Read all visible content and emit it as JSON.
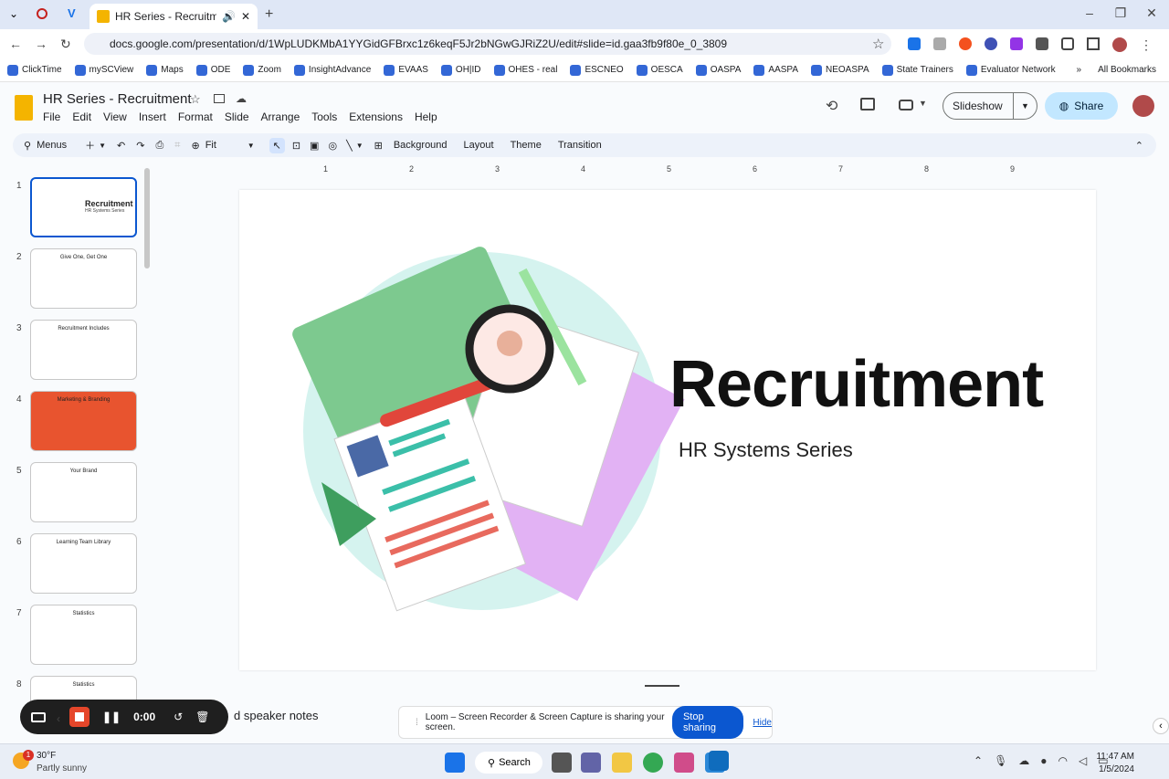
{
  "browser": {
    "tab_title": "HR Series - Recruitment - G",
    "url": "docs.google.com/presentation/d/1WpLUDKMbA1YYGidGFBrxc1z6keqF5Jr2bNGwGJRiZ2U/edit#slide=id.gaa3fb9f80e_0_3809",
    "bookmarks": [
      "ClickTime",
      "mySCView",
      "Maps",
      "ODE",
      "Zoom",
      "InsightAdvance",
      "EVAAS",
      "OH|ID",
      "OHES - real",
      "ESCNEO",
      "OESCA",
      "OASPA",
      "AASPA",
      "NEOASPA",
      "State Trainers",
      "Evaluator Network"
    ],
    "all_bookmarks": "All Bookmarks"
  },
  "doc": {
    "title": "HR Series - Recruitment",
    "menu": [
      "File",
      "Edit",
      "View",
      "Insert",
      "Format",
      "Slide",
      "Arrange",
      "Tools",
      "Extensions",
      "Help"
    ],
    "slideshow": "Slideshow",
    "share": "Share"
  },
  "toolbar": {
    "menus": "Menus",
    "zoom": "Fit",
    "items": [
      "Background",
      "Layout",
      "Theme",
      "Transition"
    ]
  },
  "ruler": [
    "1",
    "2",
    "3",
    "4",
    "5",
    "6",
    "7",
    "8",
    "9"
  ],
  "slides": [
    {
      "num": "1",
      "title": "Recruitment",
      "sub": "HR Systems Series"
    },
    {
      "num": "2",
      "title": "Give One, Get One"
    },
    {
      "num": "3",
      "title": "Recruitment Includes"
    },
    {
      "num": "4",
      "title": "Marketing & Branding"
    },
    {
      "num": "5",
      "title": "Your Brand"
    },
    {
      "num": "6",
      "title": "Learning Team Library"
    },
    {
      "num": "7",
      "title": "Statistics"
    },
    {
      "num": "8",
      "title": "Statistics"
    }
  ],
  "slide": {
    "title": "Recruitment",
    "subtitle": "HR Systems Series"
  },
  "notes": "d speaker notes",
  "loom": {
    "timer": "0:00",
    "message": "Loom – Screen Recorder & Screen Capture is sharing your screen.",
    "stop": "Stop sharing",
    "hide": "Hide"
  },
  "taskbar": {
    "temp": "30°F",
    "weather": "Partly sunny",
    "search": "Search",
    "time": "11:47 AM",
    "date": "1/5/2024",
    "badge": "1"
  }
}
